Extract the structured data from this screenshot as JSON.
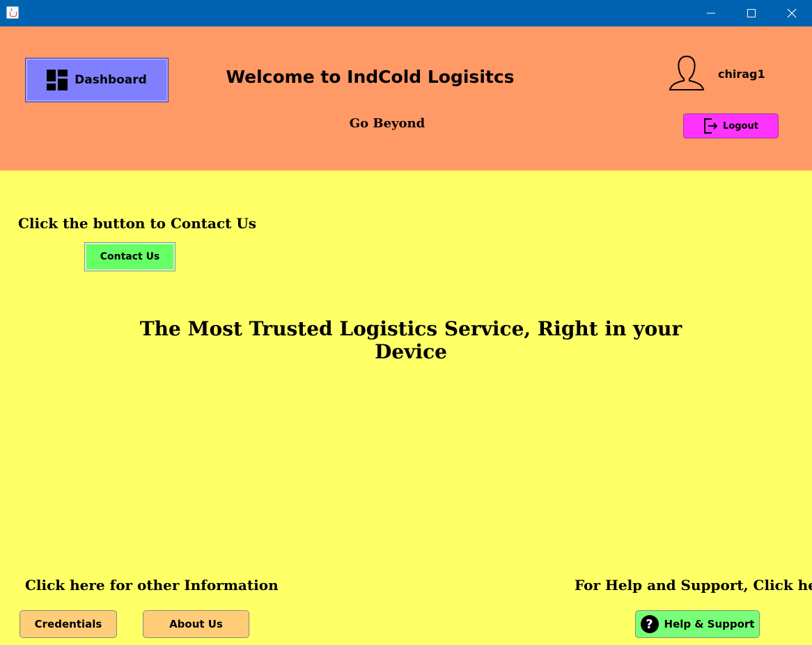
{
  "window": {
    "minimize_glyph": "—",
    "maximize_glyph": "☐",
    "close_glyph": "✕"
  },
  "header": {
    "dashboard_label": "Dashboard",
    "welcome_title": "Welcome to IndCold Logisitcs",
    "tagline": "Go Beyond",
    "username": "chirag1",
    "logout_label": "Logout"
  },
  "main": {
    "contact_prompt": "Click the button to Contact Us",
    "contact_label": "Contact Us",
    "headline": "The Most Trusted Logistics Service, Right in your Device"
  },
  "footer": {
    "info_prompt": "Click here for other Information",
    "credentials_label": "Credentials",
    "about_label": "About Us",
    "help_prompt": "For Help and Support, Click here",
    "help_label": "Help & Support",
    "help_icon_glyph": "?"
  },
  "colors": {
    "titlebar": "#0063b1",
    "header_bg": "#ff9966",
    "body_bg": "#ffff66",
    "dashboard_btn": "#8080ff",
    "logout_btn": "#ff33ff",
    "contact_btn": "#66ff66",
    "info_btns": "#ffcc77",
    "help_btn": "#77ff77"
  },
  "icons": {
    "app": "java-cup-icon",
    "dashboard": "dashboard-grid-icon",
    "user": "user-silhouette-icon",
    "logout": "logout-door-icon",
    "help": "question-circle-icon"
  }
}
